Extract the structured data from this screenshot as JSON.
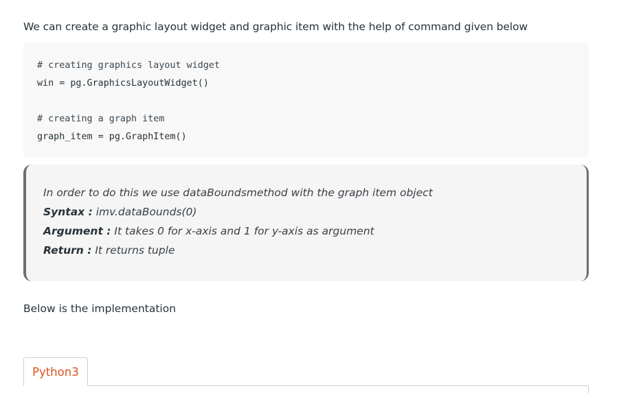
{
  "intro": {
    "text": "We can create a graphic layout widget and graphic item with the help of command given below"
  },
  "code_block": {
    "lines": [
      "# creating graphics layout widget",
      "win = pg.GraphicsLayoutWidget()",
      "",
      "# creating a graph item",
      "graph_item = pg.GraphItem()"
    ]
  },
  "note": {
    "description": "In order to do this we use dataBoundsmethod with the graph item object",
    "syntax_label": "Syntax :",
    "syntax_value": " imv.dataBounds(0)",
    "argument_label": "Argument :",
    "argument_value": " It takes 0 for x-axis and 1 for y-axis as argument",
    "return_label": "Return :",
    "return_value": " It returns tuple"
  },
  "below": {
    "text": "Below is the implementation"
  },
  "tabs": [
    {
      "label": "Python3",
      "active": true,
      "color": "#d9531e"
    }
  ]
}
